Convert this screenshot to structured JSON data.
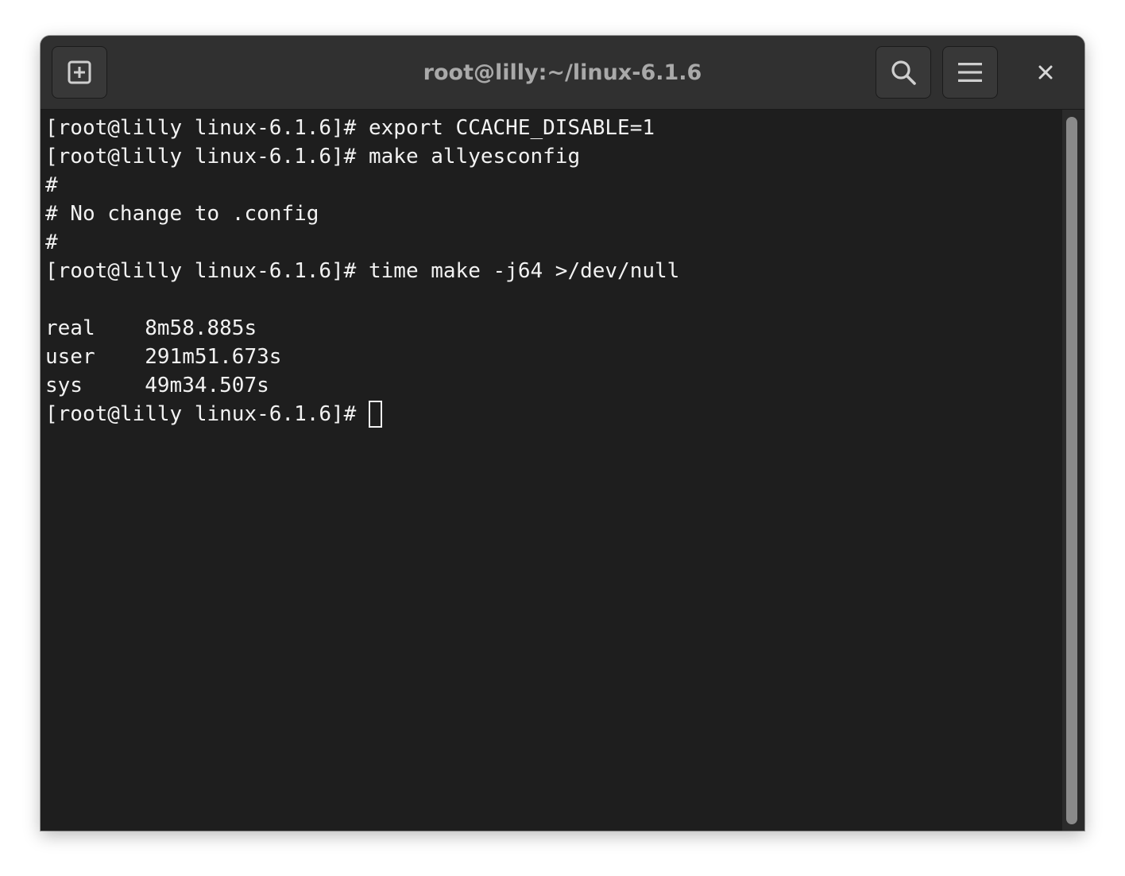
{
  "window": {
    "title": "root@lilly:~/linux-6.1.6"
  },
  "headerbar": {
    "new_tab_icon": "tab-new-icon",
    "search_icon": "search-icon",
    "menu_icon": "hamburger-menu-icon",
    "close_icon": "close-icon"
  },
  "terminal": {
    "lines": [
      "[root@lilly linux-6.1.6]# export CCACHE_DISABLE=1",
      "[root@lilly linux-6.1.6]# make allyesconfig",
      "#",
      "# No change to .config",
      "#",
      "[root@lilly linux-6.1.6]# time make -j64 >/dev/null",
      "",
      "real\t8m58.885s",
      "user\t291m51.673s",
      "sys\t49m34.507s"
    ],
    "prompt": "[root@lilly linux-6.1.6]# "
  },
  "colors": {
    "terminal_bg": "#1e1e1e",
    "headerbar_bg": "#303030",
    "text": "#f2f2f2",
    "title_text": "#a9a9a9"
  }
}
